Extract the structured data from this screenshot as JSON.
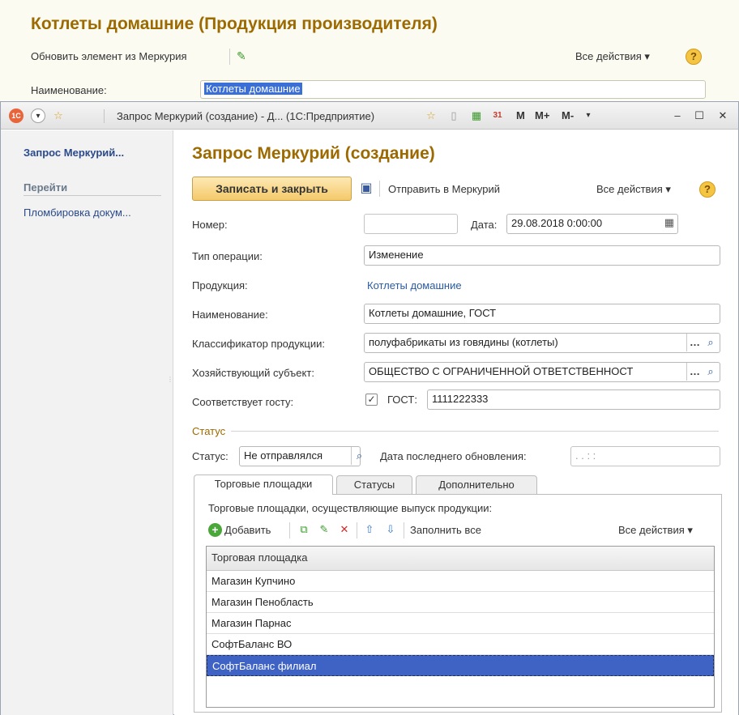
{
  "background_form": {
    "title": "Котлеты домашние (Продукция производителя)",
    "update_button": "Обновить элемент из Меркурия",
    "all_actions": "Все действия",
    "name_label": "Наименование:",
    "name_value": "Котлеты домашние"
  },
  "window": {
    "title": "Запрос Меркурий (создание) - Д... (1С:Предприятие)",
    "toolbar_m": "M",
    "toolbar_mplus": "M+",
    "toolbar_mminus": "M-"
  },
  "sidebar": {
    "title": "Запрос Меркурий...",
    "goto_label": "Перейти",
    "items": [
      {
        "label": "Пломбировка докум..."
      }
    ]
  },
  "form": {
    "title": "Запрос Меркурий (создание)",
    "save_close": "Записать и закрыть",
    "send": "Отправить в Меркурий",
    "all_actions": "Все действия",
    "number_label": "Номер:",
    "number_value": "",
    "date_label": "Дата:",
    "date_value": "29.08.2018 0:00:00",
    "op_type_label": "Тип операции:",
    "op_type_value": "Изменение",
    "product_label": "Продукция:",
    "product_value": "Котлеты домашние",
    "name_label": "Наименование:",
    "name_value": "Котлеты домашние, ГОСТ",
    "classifier_label": "Классификатор продукции:",
    "classifier_value": "полуфабрикаты из говядины (котлеты)",
    "subject_label": "Хозяйствующий субъект:",
    "subject_value": "ОБЩЕСТВО С ОГРАНИЧЕННОЙ ОТВЕТСТВЕННОСТ",
    "gost_label": "Соответствует госту:",
    "gost_checked": true,
    "gost_field_label": "ГОСТ:",
    "gost_value": "1111222333",
    "status_group_title": "Статус",
    "status_label": "Статус:",
    "status_value": "Не отправлялся",
    "last_update_label": "Дата последнего обновления:",
    "last_update_value": " .  .      :  :"
  },
  "tabs": [
    {
      "label": "Торговые площадки",
      "active": true
    },
    {
      "label": "Статусы",
      "active": false
    },
    {
      "label": "Дополнительно",
      "active": false
    }
  ],
  "trade_panel": {
    "caption": "Торговые площадки, осуществляющие выпуск продукции:",
    "add_button": "Добавить",
    "fill_all": "Заполнить все",
    "all_actions": "Все действия",
    "column_header": "Торговая площадка",
    "rows": [
      "Магазин Купчино",
      "Магазин Пенобласть",
      "Магазин Парнас",
      "СофтБаланс ВО",
      "СофтБаланс филиал"
    ],
    "selected_row": 4
  },
  "colors": {
    "title_gold": "#9c6a00",
    "link_blue": "#2a5aa0",
    "selection": "#3f63c4"
  }
}
